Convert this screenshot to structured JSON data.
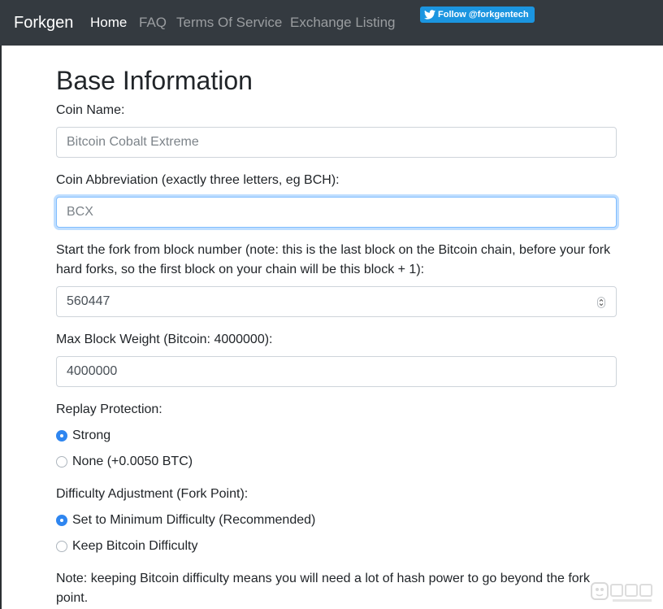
{
  "navbar": {
    "brand": "Forkgen",
    "links": [
      {
        "label": "Home",
        "active": true
      },
      {
        "label": "FAQ",
        "active": false
      },
      {
        "label": "Terms Of Service",
        "active": false
      },
      {
        "label": "Exchange Listing",
        "active": false
      }
    ],
    "twitter_button": "Follow @forkgentech",
    "twitter_icon": "twitter-bird-icon",
    "background_color": "#343a40",
    "twitter_color": "#1b95e0"
  },
  "form": {
    "title": "Base Information",
    "coin_name": {
      "label": "Coin Name:",
      "value": "",
      "placeholder": "Bitcoin Cobalt Extreme"
    },
    "coin_abbreviation": {
      "label": "Coin Abbreviation (exactly three letters, eg BCH):",
      "value": "",
      "placeholder": "BCX"
    },
    "fork_block": {
      "label": "Start the fork from block number (note: this is the last block on the Bitcoin chain, before your fork hard forks, so the first block on your chain will be this block + 1):",
      "value": "560447"
    },
    "max_block_weight": {
      "label": "Max Block Weight (Bitcoin: 4000000):",
      "value": "4000000"
    },
    "replay_protection": {
      "label": "Replay Protection:",
      "options": [
        {
          "label": "Strong",
          "checked": true
        },
        {
          "label": "None (+0.0050 BTC)",
          "checked": false
        }
      ]
    },
    "difficulty_adjustment": {
      "label": "Difficulty Adjustment (Fork Point):",
      "options": [
        {
          "label": "Set to Minimum Difficulty (Recommended)",
          "checked": true
        },
        {
          "label": "Keep Bitcoin Difficulty",
          "checked": false
        }
      ]
    },
    "difficulty_note": "Note: keeping Bitcoin difficulty means you will need a lot of hash power to go beyond the fork point."
  },
  "accent_color": "#2f86f0",
  "watermark_icon": "watermark-logo-icon"
}
